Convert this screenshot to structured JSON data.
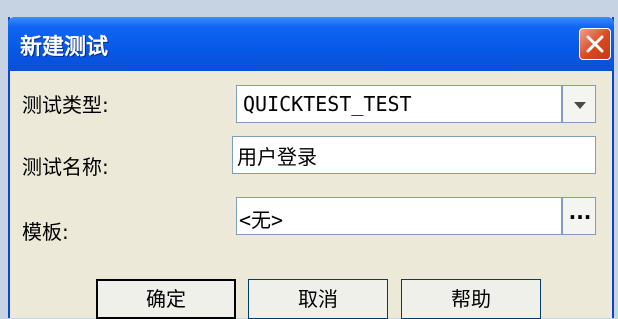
{
  "dialog": {
    "title": "新建测试",
    "close_icon": "close-icon"
  },
  "form": {
    "test_type": {
      "label": "测试类型:",
      "value": "QUICKTEST_TEST",
      "dropdown_icon": "chevron-down-icon"
    },
    "test_name": {
      "label": "测试名称:",
      "value": "用户登录"
    },
    "template": {
      "label": "模板:",
      "value": "<无>",
      "browse_label": "..."
    }
  },
  "buttons": {
    "ok_label": "确定",
    "cancel_label": "取消",
    "help_label": "帮助"
  },
  "colors": {
    "titlebar": "#0658e6",
    "dialog_bg": "#ece9d8",
    "close_button": "#d8481f",
    "field_border": "#7f9db9"
  }
}
